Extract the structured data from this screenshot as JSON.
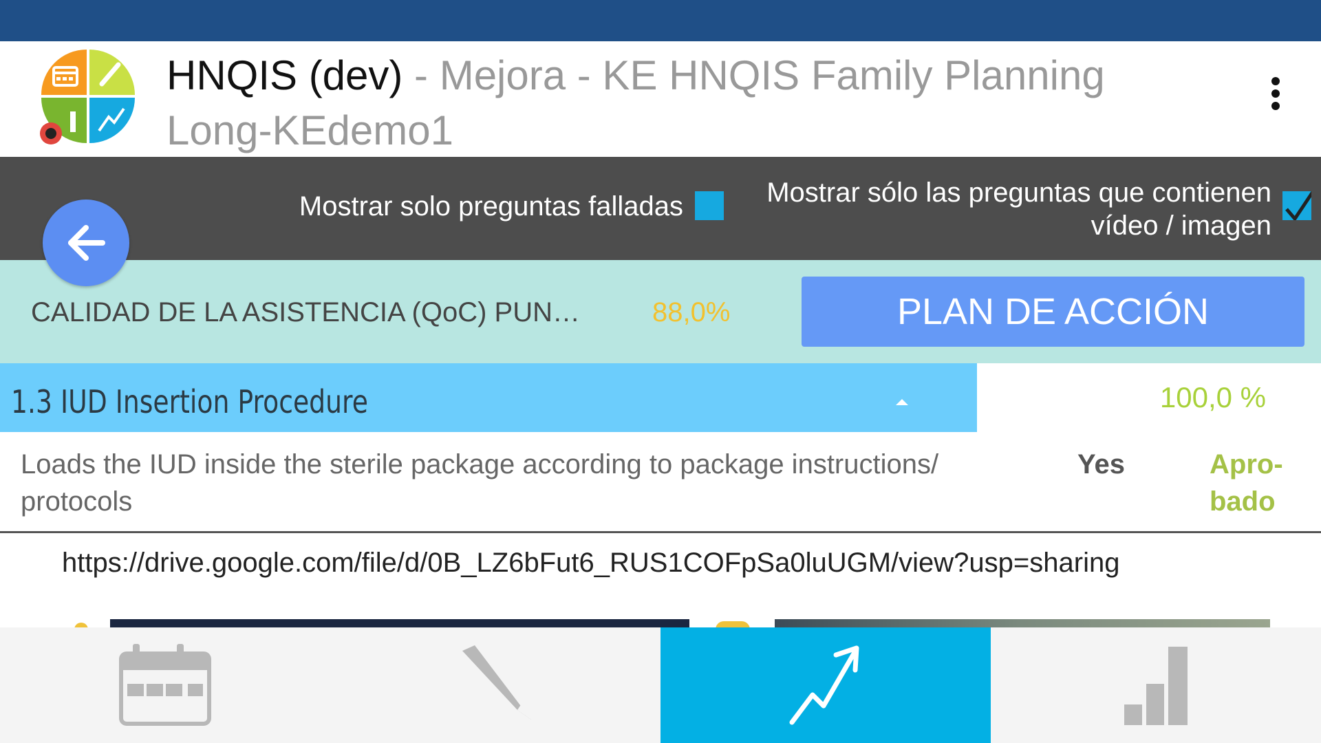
{
  "header": {
    "app_name": "HNQIS (dev)",
    "subtitle": " - Mejora - KE HNQIS Family Planning Long-KEdemo1",
    "logo_icon": "hnqis-logo-icon",
    "menu_icon": "overflow-menu-icon"
  },
  "filters": {
    "failed_only_label": "Mostrar solo preguntas falladas",
    "failed_only_checked": false,
    "media_only_label": "Mostrar sólo las preguntas que contienen vídeo / imagen",
    "media_only_checked": true
  },
  "back_button": {
    "icon": "arrow-left-icon"
  },
  "score": {
    "label": "CALIDAD DE LA ASISTENCIA (QoC) PUNTU...",
    "value": "88,0%",
    "color": "#f2c12e"
  },
  "action_button": {
    "label": "PLAN DE ACCIÓN"
  },
  "section": {
    "title": "1.3 IUD Insertion Procedure",
    "score": "100,0 %",
    "expanded": true
  },
  "question": {
    "text": "Loads the IUD inside the sterile package according to package instructions/ protocols",
    "answer": "Yes",
    "result": "Apro-bado"
  },
  "media": {
    "link": "https://drive.google.com/file/d/0B_LZ6bFut6_RUS1COFpSa0luUGM/view?usp=sharing"
  },
  "bottom_nav": {
    "tabs": [
      {
        "icon": "calendar-icon",
        "active": false
      },
      {
        "icon": "pencil-icon",
        "active": false
      },
      {
        "icon": "trending-up-icon",
        "active": true
      },
      {
        "icon": "bar-chart-icon",
        "active": false
      }
    ]
  },
  "colors": {
    "status_bar": "#1f4f87",
    "filter_bar": "#4d4d4d",
    "score_bar": "#b8e6e1",
    "action_button": "#6599f6",
    "section_header": "#6ccdfc",
    "active_tab": "#03b0e4",
    "pass_green": "#a4c147"
  }
}
